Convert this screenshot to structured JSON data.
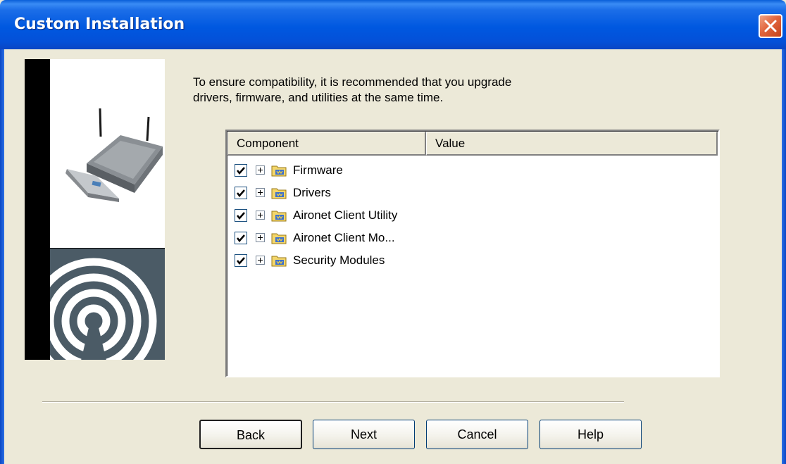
{
  "window": {
    "title": "Custom Installation",
    "close_icon": "close-icon"
  },
  "intro": {
    "line1": "To ensure compatibility, it is recommended that you upgrade",
    "line2": "drivers, firmware, and utilities at the same time."
  },
  "listview": {
    "columns": [
      "Component",
      "Value"
    ],
    "items": [
      {
        "label": "Firmware",
        "checked": true
      },
      {
        "label": "Drivers",
        "checked": true
      },
      {
        "label": "Aironet Client Utility",
        "checked": true
      },
      {
        "label": "Aironet Client Mo...",
        "checked": true
      },
      {
        "label": "Security Modules",
        "checked": true
      }
    ]
  },
  "buttons": {
    "back": "Back",
    "next": "Next",
    "cancel": "Cancel",
    "help": "Help"
  },
  "colors": {
    "titlebar": "#0058e0",
    "close_button": "#e2653d",
    "dialog_background": "#ece9d8"
  }
}
